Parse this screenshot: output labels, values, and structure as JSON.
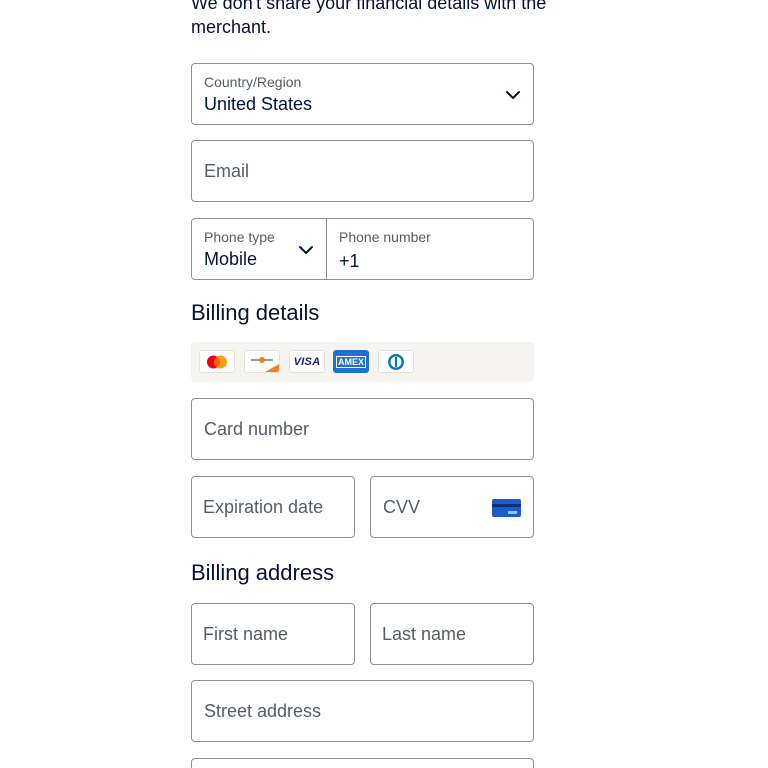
{
  "intro_text": "We don't share your financial details with the merchant.",
  "country": {
    "label": "Country/Region",
    "value": "United States"
  },
  "email": {
    "placeholder": "Email"
  },
  "phone": {
    "type_label": "Phone type",
    "type_value": "Mobile",
    "number_label": "Phone number",
    "number_value": "+1"
  },
  "billing_details": {
    "title": "Billing details",
    "card_logos": [
      "mastercard-icon",
      "discover-icon",
      "visa-icon",
      "amex-icon",
      "diners-club-icon"
    ],
    "visa_text": "VISA",
    "amex_text": "AMEX",
    "card_number_placeholder": "Card number",
    "expiration_placeholder": "Expiration date",
    "cvv_placeholder": "CVV"
  },
  "billing_address": {
    "title": "Billing address",
    "first_name_placeholder": "First name",
    "last_name_placeholder": "Last name",
    "street_placeholder": "Street address"
  },
  "colors": {
    "text_dark": "#001435",
    "text_muted": "#545d68",
    "border": "#8a8f98",
    "card_strip_bg": "#f6f4f0",
    "accent_blue": "#1c5cc9"
  }
}
